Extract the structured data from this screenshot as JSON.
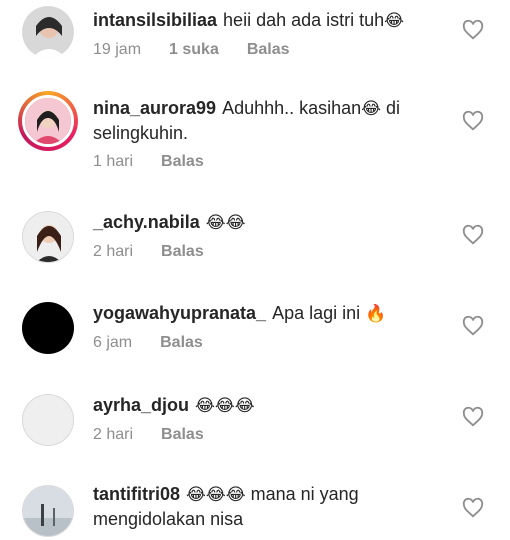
{
  "comments": [
    {
      "user": "intansilsibiliaa",
      "text": "heii dah ada istri tuh",
      "emoji": "😂",
      "time": "19 jam",
      "likes": "1 suka",
      "reply": "Balas"
    },
    {
      "user": "nina_aurora99",
      "text": "Aduhhh.. kasihan",
      "emoji": "😂",
      "text2": " di selingkuhin.",
      "time": "1 hari",
      "reply": "Balas"
    },
    {
      "user": "_achy.nabila",
      "text": "",
      "emoji": "😂😂",
      "time": "2 hari",
      "reply": "Balas"
    },
    {
      "user": "yogawahyupranata_",
      "text": "Apa lagi ini",
      "emoji": "🔥",
      "time": "6 jam",
      "reply": "Balas"
    },
    {
      "user": "ayrha_djou",
      "text": "",
      "emoji": "😂😂😂",
      "time": "2 hari",
      "reply": "Balas"
    },
    {
      "user": "tantifitri08",
      "text": "",
      "emoji": "😂😂😂",
      "text2": " mana ni yang mengidolakan nisa"
    }
  ],
  "colors": {
    "text": "#262626",
    "muted": "#8e8e8e",
    "avatar_gray": "#efefef"
  },
  "icons": {
    "like": "heart-outline-icon"
  }
}
